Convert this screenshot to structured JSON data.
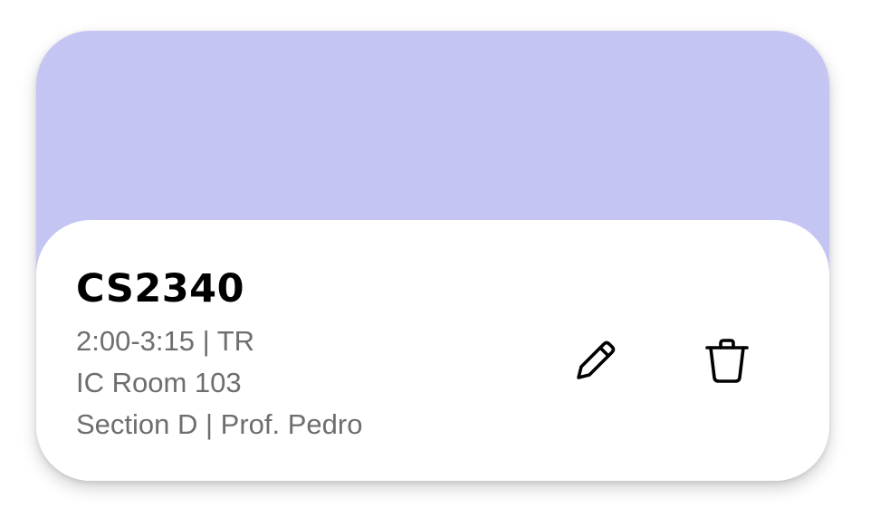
{
  "course": {
    "code": "CS2340",
    "schedule": "2:00-3:15 | TR",
    "room": "IC Room 103",
    "section_instructor": "Section D | Prof. Pedro"
  },
  "actions": {
    "edit_icon": "pencil-icon",
    "delete_icon": "trash-icon"
  },
  "colors": {
    "banner": "#c5c5f4",
    "card": "#ffffff",
    "title": "#000000",
    "meta_text": "#6e6e6e"
  }
}
